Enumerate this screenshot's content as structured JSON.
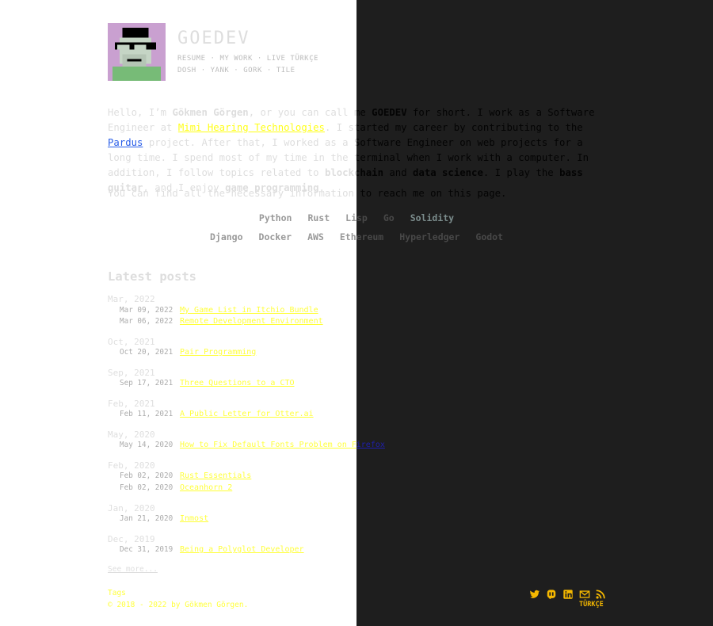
{
  "header": {
    "title": "GOEDEV",
    "nav_row1": [
      "RESUME",
      "MY WORK",
      "LIVE",
      "TÜRKÇE"
    ],
    "nav_row2": [
      "DOSH",
      "YANK",
      "GORK",
      "TILE"
    ],
    "separator": "·"
  },
  "intro": {
    "p1": {
      "t1": "Hello, I’m ",
      "name": "Gökmen Görgen",
      "t2": ", or you can call me ",
      "nick": "GOEDEV",
      "t3": " for short. I work as a Software Engineer at ",
      "company_link": "Mimi Hearing Technologies",
      "t4": ". I started my career by contributing to the ",
      "pardus_link": "Pardus",
      "t5": " project. After that, I worked as a Software Engineer on web projects for a long time. I spend most of my time in the terminal when I work with a computer. In addition, I follow topics related to ",
      "blockchain": "blockchain",
      "t6": " and ",
      "data_science": "data science",
      "t7": ". I play the ",
      "bass": "bass guitar",
      "t8": ", and I enjoy ",
      "game": "game programming",
      "t9": "."
    },
    "p2": "You can find all the necessary information to reach me on this page."
  },
  "skills": {
    "row1": [
      "Python",
      "Rust",
      "Lisp",
      "Go",
      "Solidity"
    ],
    "row2": [
      "Django",
      "Docker",
      "AWS",
      "Ethereum",
      "Hyperledger",
      "Godot"
    ]
  },
  "posts": {
    "title": "Latest posts",
    "groups": [
      {
        "month": "Mar, 2022",
        "items": [
          {
            "date": "Mar 09, 2022",
            "title": "My Game List in Itchio Bundle"
          },
          {
            "date": "Mar 06, 2022",
            "title": "Remote Development Environment"
          }
        ]
      },
      {
        "month": "Oct, 2021",
        "items": [
          {
            "date": "Oct 20, 2021",
            "title": "Pair Programming"
          }
        ]
      },
      {
        "month": "Sep, 2021",
        "items": [
          {
            "date": "Sep 17, 2021",
            "title": "Three Questions to a CTO"
          }
        ]
      },
      {
        "month": "Feb, 2021",
        "items": [
          {
            "date": "Feb 11, 2021",
            "title": "A Public Letter for Otter.ai"
          }
        ]
      },
      {
        "month": "May, 2020",
        "items": [
          {
            "date": "May 14, 2020",
            "title": "How to Fix Default Fonts Problem on Firefox"
          }
        ]
      },
      {
        "month": "Feb, 2020",
        "items": [
          {
            "date": "Feb 02, 2020",
            "title": "Rust Essentials"
          },
          {
            "date": "Feb 02, 2020",
            "title": "Oceanhorn 2"
          }
        ]
      },
      {
        "month": "Jan, 2020",
        "items": [
          {
            "date": "Jan 21, 2020",
            "title": "Inmost"
          }
        ]
      },
      {
        "month": "Dec, 2019",
        "items": [
          {
            "date": "Dec 31, 2019",
            "title": "Being a Polyglot Developer"
          }
        ]
      }
    ],
    "see_more": "See more..."
  },
  "footer": {
    "tags": "Tags",
    "copyright": "© 2018 - 2022 by Gökmen Görgen.",
    "lang": "TÜRKÇE",
    "social_icons": [
      "twitter-icon",
      "mastodon-icon",
      "linkedin-icon",
      "email-icon",
      "rss-icon"
    ]
  },
  "colors": {
    "dark_half": "#1e1e1e",
    "link": "#0000cc",
    "accent": "#f5b800"
  }
}
